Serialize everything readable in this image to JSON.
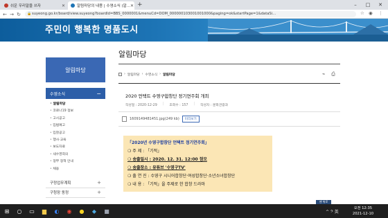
{
  "browser": {
    "tabs": [
      {
        "title": "쉬운 우리말을 쓰자",
        "favicon_color": "#c0392b"
      },
      {
        "title": "알림마당의 내용 | 수영소식 (알...",
        "favicon_color": "#1d74b5"
      }
    ],
    "new_tab": "+",
    "url": "suyeong.go.kr/board/view.suyeong?boardId=BBS_0000001&menuCd=DOM_000000103001001000&paging=ok&startPage=1&dataSi..."
  },
  "banner": {
    "slogan": "주민이 행복한 명품도시"
  },
  "page": {
    "title": "알림마당"
  },
  "sidebar": {
    "heading": "알림마당",
    "category": "수영소식",
    "category_sign": "−",
    "sub_items": [
      "알림마당",
      "코로나19 정보",
      "고시공고",
      "입법예고",
      "입찰공고",
      "행사·교육",
      "보도자료",
      "새수영회의",
      "정부 정책 안내",
      "채용"
    ],
    "active_index": 0,
    "more_sign": "+",
    "rows": [
      {
        "label": "구정업무계획",
        "sign": "+"
      },
      {
        "label": "구청장 동정",
        "sign": "+"
      }
    ]
  },
  "breadcrumb": {
    "items": [
      "홈",
      "알림마당",
      "수영소식",
      "알림마당"
    ]
  },
  "post": {
    "title": "2020 언택트 수영구합창단 정기연주회 개최",
    "date_label": "작성일 : 2020-12-29",
    "views_label": "조회수 : 157",
    "author_label": "작성자 : 문화관광과",
    "attachment": "1609149481451.jpg(249 kb)",
    "preview_btn": "미리보기"
  },
  "notice": {
    "headline": "「2020년 수영구합창단 언택트 정기연주회」",
    "lines": [
      "❍ 주 제 : 「기적」",
      "❍ 송출일시 : 2020. 12. 31. 12:00 정오",
      "❍ 송출장소 : 유튜브 '수영구TV'",
      "❍ 출 연 진 : 수영구 시니어합창단·여성합창단·소년소녀합창단",
      "❍ 내 용 : 「기적」을 주제로 한 합창 드라마"
    ]
  },
  "top_button": "맨 위로",
  "taskbar": {
    "tray_lang": "^ 𝄢 英",
    "time": "오전 12:35",
    "date": "2021-12-10"
  }
}
